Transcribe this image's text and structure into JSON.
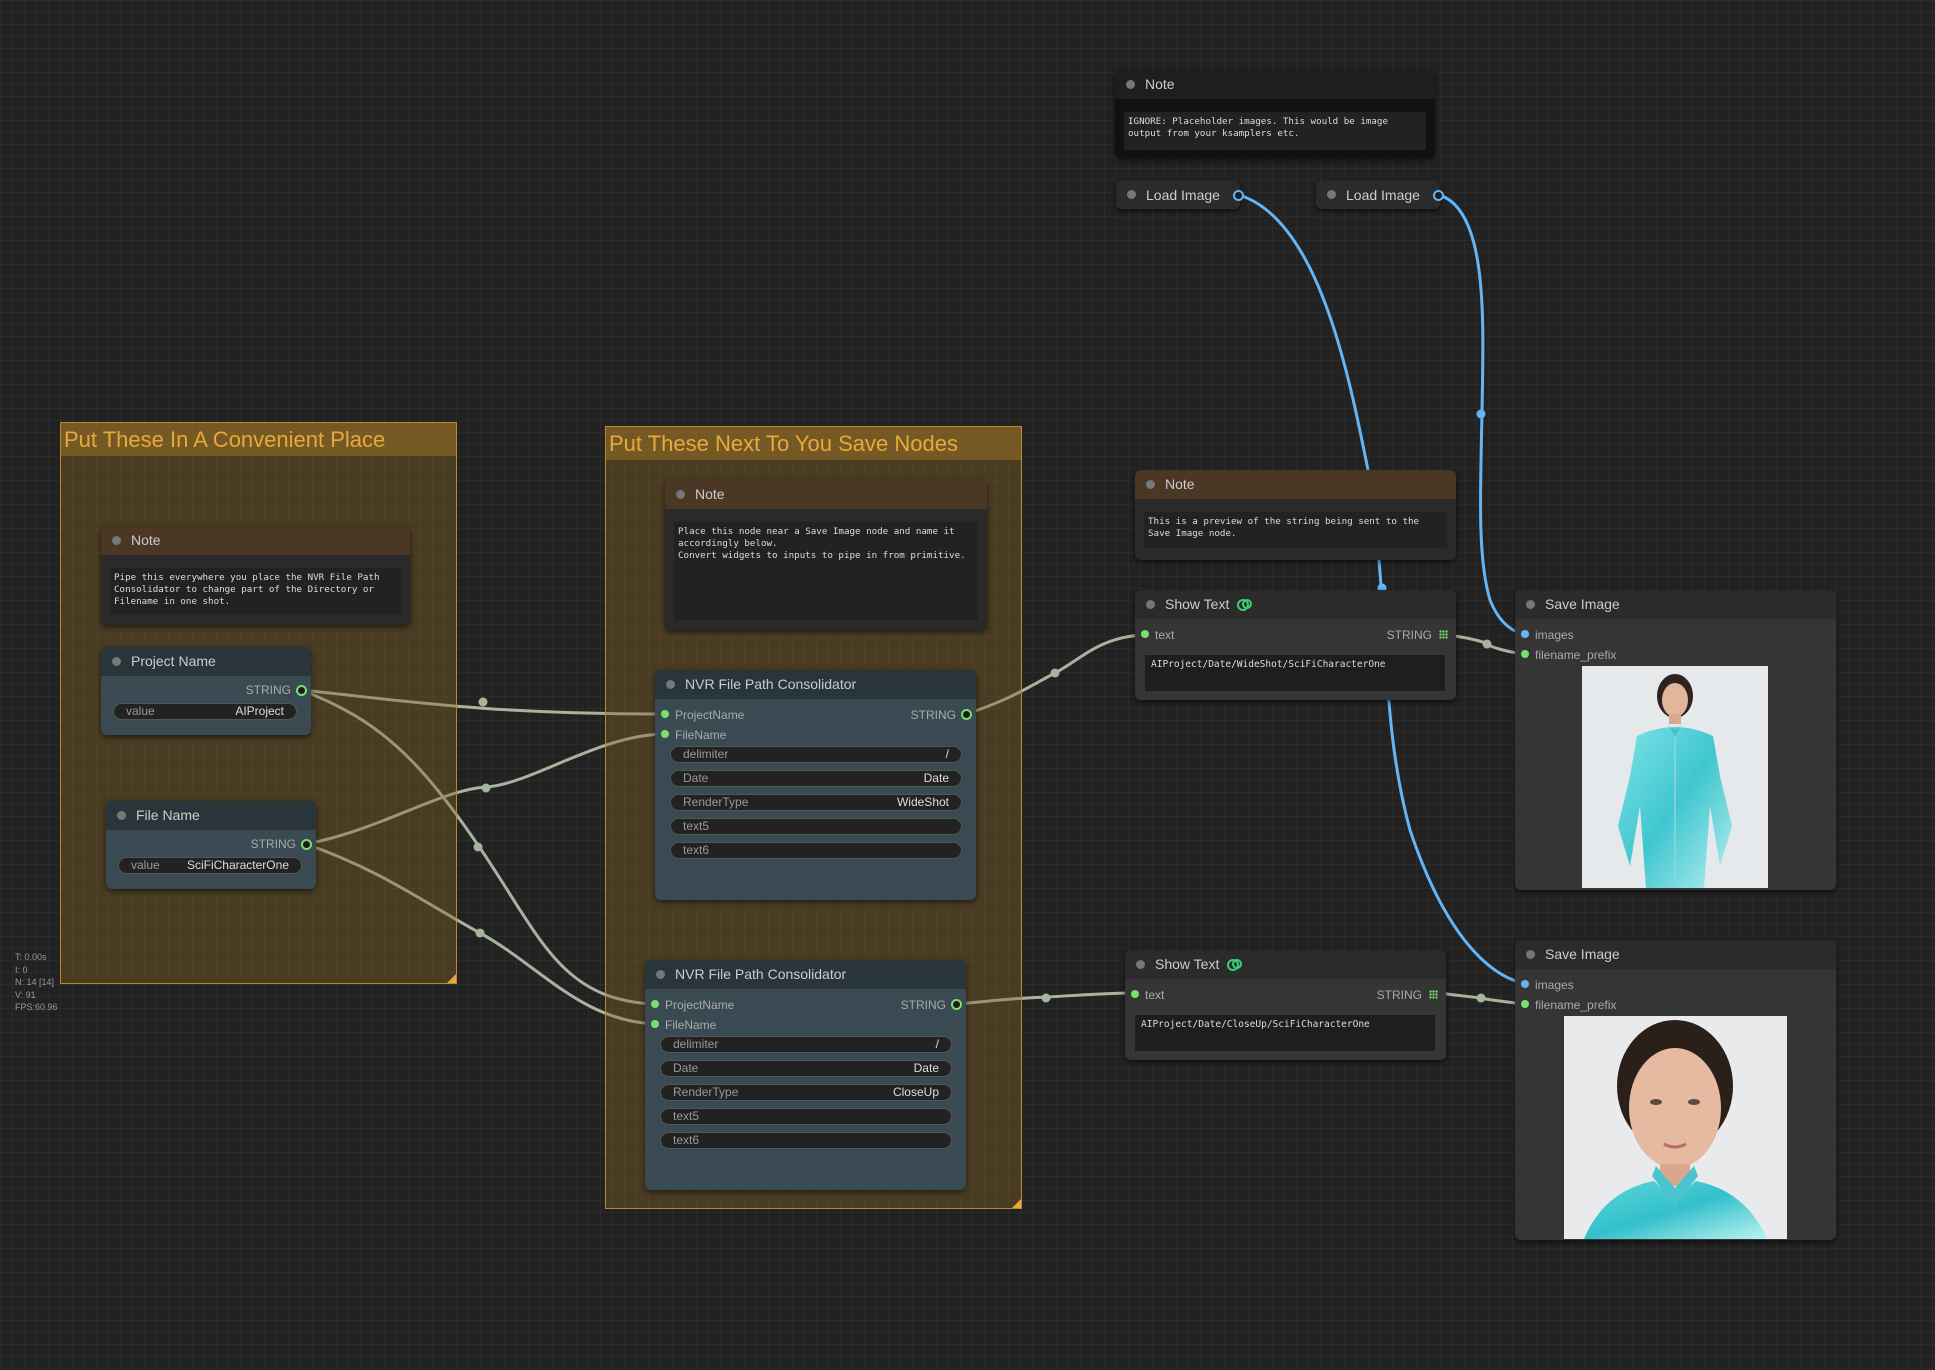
{
  "groups": [
    {
      "title": "Put These In A Convenient Place"
    },
    {
      "title": "Put These Next To You Save Nodes"
    }
  ],
  "notes": {
    "top": {
      "title": "Note",
      "text": "IGNORE: Placeholder images. This would be image\noutput from your ksamplers etc."
    },
    "left": {
      "title": "Note",
      "text": "Pipe this everywhere you place the NVR File Path\nConsolidator to change part of the Directory or\nFilename in one shot."
    },
    "middle": {
      "title": "Note",
      "text": "Place this node near a Save Image node and name it\naccordingly below.\nConvert widgets to inputs to pipe in from primitive."
    },
    "right": {
      "title": "Note",
      "text": "This is a preview of the string being sent to the\nSave Image node."
    }
  },
  "load_images": [
    {
      "title": "Load Image"
    },
    {
      "title": "Load Image"
    }
  ],
  "project_name": {
    "title": "Project Name",
    "output": "STRING",
    "widget_label": "value",
    "widget_value": "AIProject"
  },
  "file_name": {
    "title": "File Name",
    "output": "STRING",
    "widget_label": "value",
    "widget_value": "SciFiCharacterOne"
  },
  "consolidator_a": {
    "title": "NVR File Path Consolidator",
    "inputs": [
      "ProjectName",
      "FileName"
    ],
    "output": "STRING",
    "widgets": [
      {
        "label": "delimiter",
        "value": "/"
      },
      {
        "label": "Date",
        "value": "Date"
      },
      {
        "label": "RenderType",
        "value": "WideShot"
      },
      {
        "label": "text5",
        "value": ""
      },
      {
        "label": "text6",
        "value": ""
      }
    ]
  },
  "consolidator_b": {
    "title": "NVR File Path Consolidator",
    "inputs": [
      "ProjectName",
      "FileName"
    ],
    "output": "STRING",
    "widgets": [
      {
        "label": "delimiter",
        "value": "/"
      },
      {
        "label": "Date",
        "value": "Date"
      },
      {
        "label": "RenderType",
        "value": "CloseUp"
      },
      {
        "label": "text5",
        "value": ""
      },
      {
        "label": "text6",
        "value": ""
      }
    ]
  },
  "show_text_a": {
    "title": "Show Text",
    "input": "text",
    "output": "STRING",
    "value": "AIProject/Date/WideShot/SciFiCharacterOne"
  },
  "show_text_b": {
    "title": "Show Text",
    "input": "text",
    "output": "STRING",
    "value": "AIProject/Date/CloseUp/SciFiCharacterOne"
  },
  "save_image_a": {
    "title": "Save Image",
    "inputs": [
      "images",
      "filename_prefix"
    ]
  },
  "save_image_b": {
    "title": "Save Image",
    "inputs": [
      "images",
      "filename_prefix"
    ]
  },
  "stats": [
    "T: 0.00s",
    "I: 0",
    "N: 14 [14]",
    "V: 91",
    "FPS:60.96"
  ],
  "colors": {
    "string_link": "#a6b49e",
    "image_link": "#64b5f6",
    "group_title": "#e8a93a",
    "string_slot": "#7bdf6f"
  }
}
